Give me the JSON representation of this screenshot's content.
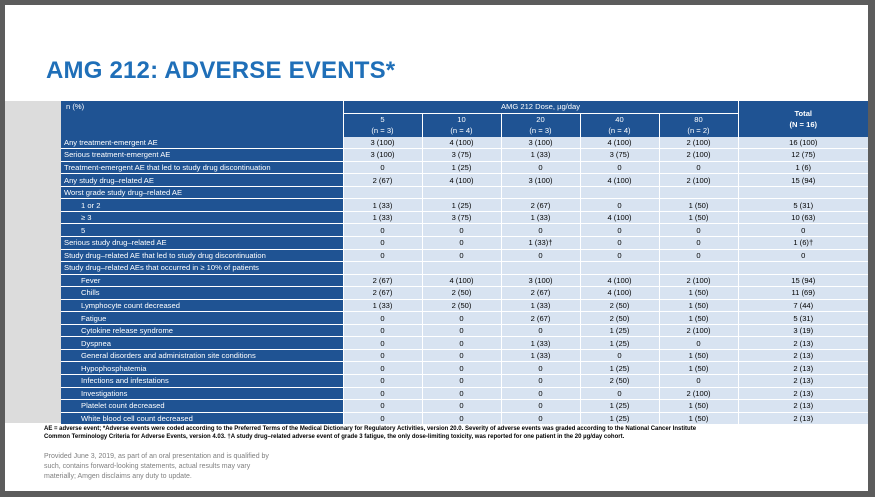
{
  "title": "AMG 212: ADVERSE EVENTS*",
  "table": {
    "corner_header": "n (%)",
    "dose_group_header": "AMG 212 Dose, µg/day",
    "columns": [
      {
        "dose": "5",
        "n": "(n = 3)"
      },
      {
        "dose": "10",
        "n": "(n = 4)"
      },
      {
        "dose": "20",
        "n": "(n = 3)"
      },
      {
        "dose": "40",
        "n": "(n = 4)"
      },
      {
        "dose": "80",
        "n": "(n = 2)"
      }
    ],
    "total_header": "Total",
    "total_n": "(N = 16)",
    "rows": [
      {
        "label": "Any treatment-emergent AE",
        "indent": false,
        "values": [
          "3 (100)",
          "4 (100)",
          "3 (100)",
          "4 (100)",
          "2 (100)",
          "16 (100)"
        ]
      },
      {
        "label": "Serious treatment-emergent AE",
        "indent": false,
        "values": [
          "3 (100)",
          "3 (75)",
          "1 (33)",
          "3 (75)",
          "2 (100)",
          "12 (75)"
        ]
      },
      {
        "label": "Treatment-emergent AE that led to study drug discontinuation",
        "indent": false,
        "values": [
          "0",
          "1 (25)",
          "0",
          "0",
          "0",
          "1 (6)"
        ]
      },
      {
        "label": "Any study drug–related AE",
        "indent": false,
        "values": [
          "2 (67)",
          "4 (100)",
          "3 (100)",
          "4 (100)",
          "2 (100)",
          "15 (94)"
        ]
      },
      {
        "label": "Worst grade study drug–related AE",
        "indent": false,
        "values": [
          "",
          "",
          "",
          "",
          "",
          ""
        ]
      },
      {
        "label": "1 or 2",
        "indent": true,
        "values": [
          "1 (33)",
          "1 (25)",
          "2 (67)",
          "0",
          "1 (50)",
          "5 (31)"
        ]
      },
      {
        "label": "≥ 3",
        "indent": true,
        "values": [
          "1 (33)",
          "3 (75)",
          "1 (33)",
          "4 (100)",
          "1 (50)",
          "10 (63)"
        ]
      },
      {
        "label": "5",
        "indent": true,
        "values": [
          "0",
          "0",
          "0",
          "0",
          "0",
          "0"
        ]
      },
      {
        "label": "Serious study drug–related AE",
        "indent": false,
        "values": [
          "0",
          "0",
          "1 (33)†",
          "0",
          "0",
          "1 (6)†"
        ]
      },
      {
        "label": "Study drug–related AE that led to study drug discontinuation",
        "indent": false,
        "values": [
          "0",
          "0",
          "0",
          "0",
          "0",
          "0"
        ]
      },
      {
        "label": "Study drug–related AEs that occurred in ≥ 10% of patients",
        "indent": false,
        "values": [
          "",
          "",
          "",
          "",
          "",
          ""
        ]
      },
      {
        "label": "Fever",
        "indent": true,
        "values": [
          "2 (67)",
          "4 (100)",
          "3 (100)",
          "4 (100)",
          "2 (100)",
          "15 (94)"
        ]
      },
      {
        "label": "Chills",
        "indent": true,
        "values": [
          "2 (67)",
          "2 (50)",
          "2 (67)",
          "4 (100)",
          "1 (50)",
          "11 (69)"
        ]
      },
      {
        "label": "Lymphocyte count decreased",
        "indent": true,
        "values": [
          "1 (33)",
          "2 (50)",
          "1 (33)",
          "2 (50)",
          "1 (50)",
          "7 (44)"
        ]
      },
      {
        "label": "Fatigue",
        "indent": true,
        "values": [
          "0",
          "0",
          "2 (67)",
          "2 (50)",
          "1 (50)",
          "5 (31)"
        ]
      },
      {
        "label": "Cytokine release syndrome",
        "indent": true,
        "values": [
          "0",
          "0",
          "0",
          "1 (25)",
          "2 (100)",
          "3 (19)"
        ]
      },
      {
        "label": "Dyspnea",
        "indent": true,
        "values": [
          "0",
          "0",
          "1 (33)",
          "1 (25)",
          "0",
          "2 (13)"
        ]
      },
      {
        "label": "General disorders and administration site conditions",
        "indent": true,
        "values": [
          "0",
          "0",
          "1 (33)",
          "0",
          "1 (50)",
          "2 (13)"
        ]
      },
      {
        "label": "Hypophosphatemia",
        "indent": true,
        "values": [
          "0",
          "0",
          "0",
          "1 (25)",
          "1 (50)",
          "2 (13)"
        ]
      },
      {
        "label": "Infections and infestations",
        "indent": true,
        "values": [
          "0",
          "0",
          "0",
          "2 (50)",
          "0",
          "2 (13)"
        ]
      },
      {
        "label": "Investigations",
        "indent": true,
        "values": [
          "0",
          "0",
          "0",
          "0",
          "2 (100)",
          "2 (13)"
        ]
      },
      {
        "label": "Platelet count decreased",
        "indent": true,
        "values": [
          "0",
          "0",
          "0",
          "1 (25)",
          "1 (50)",
          "2 (13)"
        ]
      },
      {
        "label": "White blood cell count decreased",
        "indent": true,
        "values": [
          "0",
          "0",
          "0",
          "1 (25)",
          "1 (50)",
          "2 (13)"
        ]
      }
    ]
  },
  "footnote_line1": "AE = adverse event; *Adverse events were coded according to the Preferred Terms of the Medical Dictionary for Regulatory Activities, version 20.0. Severity of adverse events was graded according to the National Cancer Institute",
  "footnote_line2": "Common Terminology Criteria for Adverse Events, version 4.03. †A study drug–related adverse event of grade 3 fatigue, the only dose-limiting toxicity, was reported for one patient in the 20 µg/day cohort.",
  "disclaimer": [
    "Provided June 3, 2019, as part of an oral presentation and is qualified by",
    "such, contains forward-looking statements, actual results may vary",
    "materially; Amgen disclaims any duty to update."
  ]
}
